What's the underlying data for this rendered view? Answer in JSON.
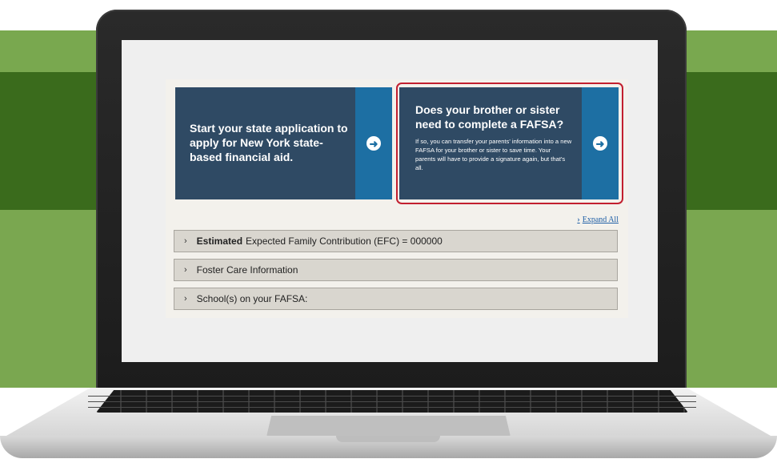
{
  "cards": [
    {
      "text": "Start your state application to apply for New York state-based financial aid.",
      "arrow_icon": "arrow-right-circle-icon"
    },
    {
      "title": "Does your brother or sister need to complete a FAFSA?",
      "body": "If so, you can transfer your parents' information into a new FAFSA for your brother or sister to save time. Your parents will have to provide a signature again, but that's all.",
      "arrow_icon": "arrow-right-circle-icon"
    }
  ],
  "expand_all_label": "Expand All",
  "accordion": [
    {
      "bold": "Estimated",
      "text": "Expected Family Contribution (EFC) = 000000"
    },
    {
      "bold": "",
      "text": "Foster Care Information"
    },
    {
      "bold": "",
      "text": "School(s) on your FAFSA:"
    }
  ],
  "colors": {
    "card_bg": "#2f4a64",
    "arrow_bg": "#1d6fa3",
    "highlight_border": "#c21f2f",
    "band_dark": "#3a6b1c",
    "band_light": "#79a84f"
  }
}
